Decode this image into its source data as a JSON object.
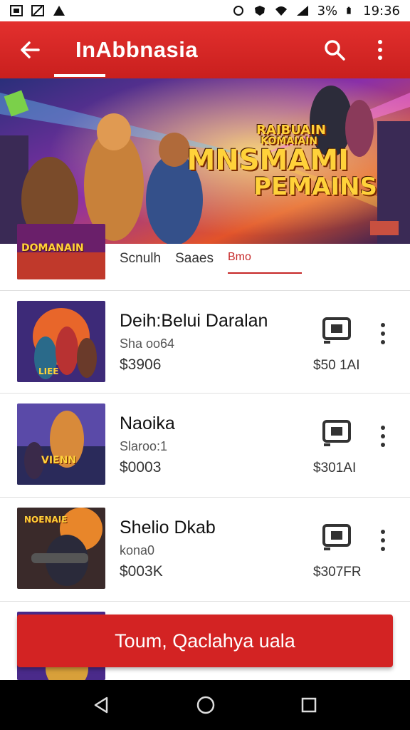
{
  "status_bar": {
    "battery": "3%",
    "time": "19:36"
  },
  "app_bar": {
    "title": "InAbbnasia"
  },
  "banner": {
    "line1": "RAIBUAIN",
    "line2": "KOMAIAIN",
    "line3": "MNSMAMI",
    "line4": "PEMAINS"
  },
  "filter_row": {
    "thumb_text": "DOMANAIN",
    "tabs": [
      "Scnulh",
      "Saaes",
      "Bmo"
    ]
  },
  "items": [
    {
      "title": "Deih:Belui Daralan",
      "sub": "Sha oo64",
      "price": "$3906",
      "price2": "$50 1AI",
      "thumb_text": "LIEE"
    },
    {
      "title": "Naoika",
      "sub": "Slaroo:1",
      "price": "$0003",
      "price2": "$301AI",
      "thumb_text": "VIENN"
    },
    {
      "title": "Shelio Dkab",
      "sub": "kona0",
      "price": "$003K",
      "price2": "$307FR",
      "thumb_text": "NOENAIE"
    }
  ],
  "cta": {
    "label": "Toum, Qaclahya uala"
  },
  "colors": {
    "accent": "#d32323",
    "app_bar": "#e3302e"
  }
}
